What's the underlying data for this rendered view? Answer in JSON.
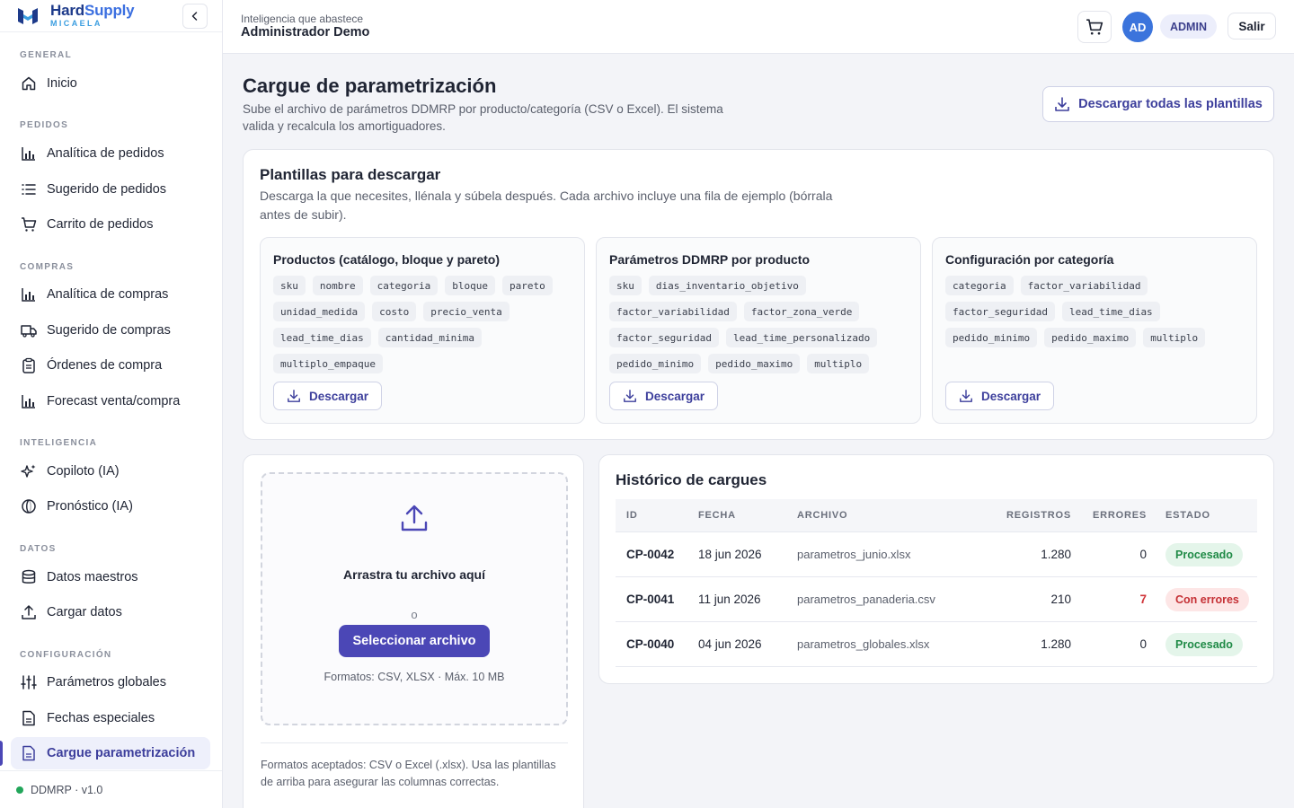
{
  "brand": {
    "name_part1": "Hard",
    "name_part2": "Supply",
    "sub": "MICAELA",
    "color": "#1d3a8a"
  },
  "sidebar": {
    "sections": [
      {
        "title": "GENERAL",
        "items": [
          {
            "label": "Inicio",
            "icon": "home-icon"
          }
        ]
      },
      {
        "title": "PEDIDOS",
        "items": [
          {
            "label": "Analítica de pedidos",
            "icon": "bar-chart-icon"
          },
          {
            "label": "Sugerido de pedidos",
            "icon": "list-icon"
          },
          {
            "label": "Carrito de pedidos",
            "icon": "cart-icon"
          }
        ]
      },
      {
        "title": "COMPRAS",
        "items": [
          {
            "label": "Analítica de compras",
            "icon": "bar-chart-icon"
          },
          {
            "label": "Sugerido de compras",
            "icon": "truck-icon"
          },
          {
            "label": "Órdenes de compra",
            "icon": "clipboard-icon"
          },
          {
            "label": "Forecast venta/compra",
            "icon": "bar-chart-icon"
          }
        ]
      },
      {
        "title": "INTELIGENCIA",
        "items": [
          {
            "label": "Copiloto (IA)",
            "icon": "sparkles-icon"
          },
          {
            "label": "Pronóstico (IA)",
            "icon": "brain-icon"
          }
        ]
      },
      {
        "title": "DATOS",
        "items": [
          {
            "label": "Datos maestros",
            "icon": "database-icon"
          },
          {
            "label": "Cargar datos",
            "icon": "upload-icon"
          }
        ]
      },
      {
        "title": "CONFIGURACIÓN",
        "items": [
          {
            "label": "Parámetros globales",
            "icon": "sliders-icon"
          },
          {
            "label": "Fechas especiales",
            "icon": "file-icon"
          },
          {
            "label": "Cargue parametrización",
            "icon": "file-icon",
            "active": true
          }
        ]
      }
    ],
    "footer": "DDMRP · v1.0"
  },
  "topbar": {
    "subtitle": "Inteligencia que abastece",
    "title": "Administrador Demo",
    "avatar": "AD",
    "role": "ADMIN",
    "logout": "Salir"
  },
  "page": {
    "title": "Cargue de parametrización",
    "description": "Sube el archivo de parámetros DDMRP por producto/categoría (CSV o Excel). El sistema valida y recalcula los amortiguadores.",
    "download_all": "Descargar todas las plantillas"
  },
  "templates": {
    "title": "Plantillas para descargar",
    "description": "Descarga la que necesites, llénala y súbela después. Cada archivo incluye una fila de ejemplo (bórrala antes de subir).",
    "items": [
      {
        "title": "Productos (catálogo, bloque y pareto)",
        "fields": [
          "sku",
          "nombre",
          "categoria",
          "bloque",
          "pareto",
          "unidad_medida",
          "costo",
          "precio_venta",
          "lead_time_dias",
          "cantidad_minima",
          "multiplo_empaque"
        ],
        "button": "Descargar"
      },
      {
        "title": "Parámetros DDMRP por producto",
        "fields": [
          "sku",
          "dias_inventario_objetivo",
          "factor_variabilidad",
          "factor_zona_verde",
          "factor_seguridad",
          "lead_time_personalizado",
          "pedido_minimo",
          "pedido_maximo",
          "multiplo"
        ],
        "button": "Descargar"
      },
      {
        "title": "Configuración por categoría",
        "fields": [
          "categoria",
          "factor_variabilidad",
          "factor_seguridad",
          "lead_time_dias",
          "pedido_minimo",
          "pedido_maximo",
          "multiplo"
        ],
        "button": "Descargar"
      }
    ]
  },
  "upload": {
    "title": "Arrastra tu archivo aquí",
    "or": "o",
    "button": "Seleccionar archivo",
    "formats": "Formatos: CSV, XLSX · Máx. 10 MB",
    "note": "Formatos aceptados: CSV o Excel (.xlsx). Usa las plantillas de arriba para asegurar las columnas correctas."
  },
  "history": {
    "title": "Histórico de cargues",
    "columns": [
      "ID",
      "FECHA",
      "ARCHIVO",
      "REGISTROS",
      "ERRORES",
      "ESTADO"
    ],
    "rows": [
      {
        "id": "CP-0042",
        "date": "18 jun 2026",
        "file": "parametros_junio.xlsx",
        "records": "1.280",
        "errors": "0",
        "status": "Procesado",
        "status_kind": "ok"
      },
      {
        "id": "CP-0041",
        "date": "11 jun 2026",
        "file": "parametros_panaderia.csv",
        "records": "210",
        "errors": "7",
        "status": "Con errores",
        "status_kind": "bad"
      },
      {
        "id": "CP-0040",
        "date": "04 jun 2026",
        "file": "parametros_globales.xlsx",
        "records": "1.280",
        "errors": "0",
        "status": "Procesado",
        "status_kind": "ok"
      }
    ]
  },
  "colors": {
    "accent": "#4b47b6",
    "success": "#1f8a46",
    "danger": "#c53035"
  }
}
